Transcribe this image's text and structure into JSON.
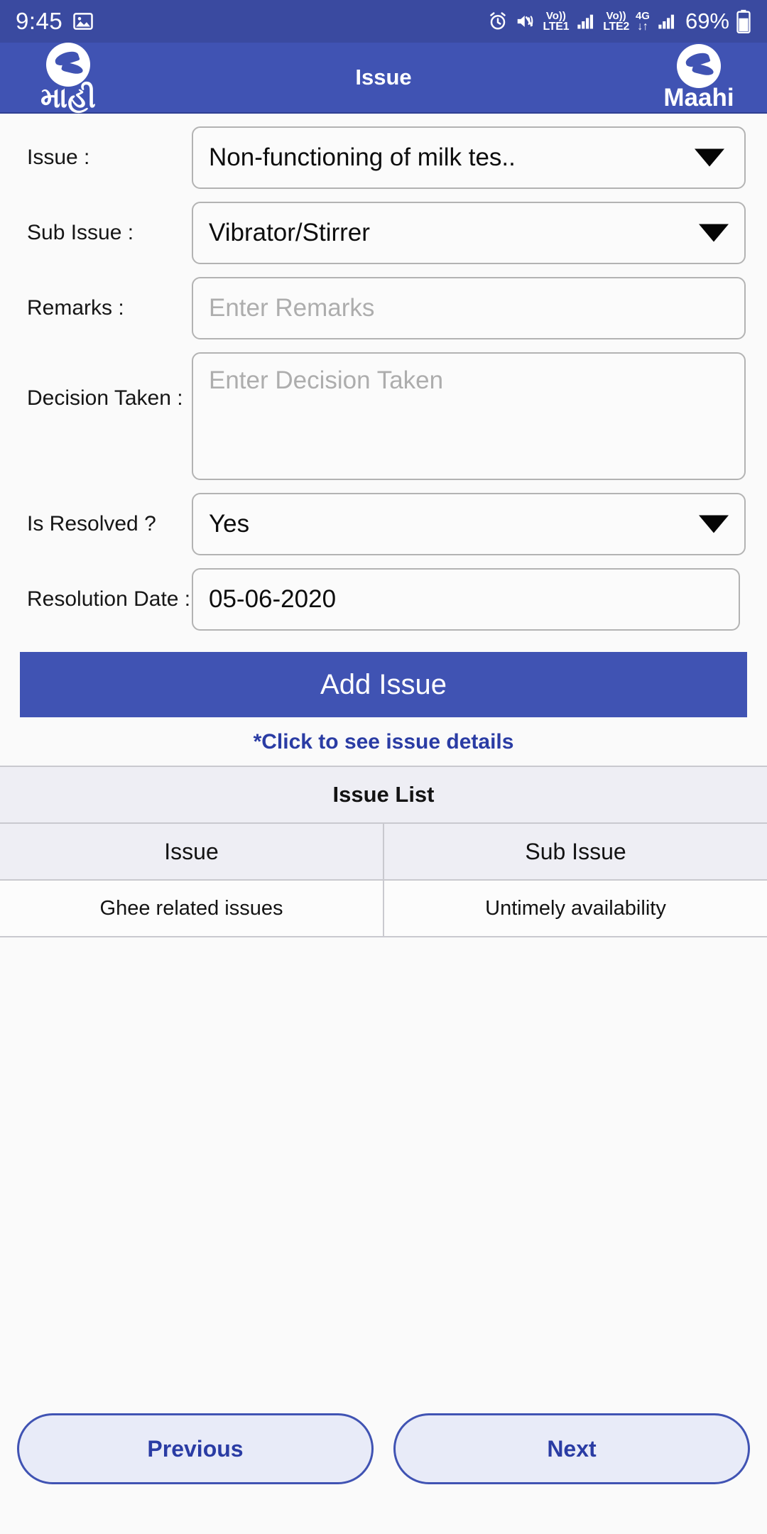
{
  "status_bar": {
    "time": "9:45",
    "battery_percent": "69%",
    "icons": {
      "gallery": "image-icon",
      "alarm": "alarm-icon",
      "mute": "volume-mute-vibrate-icon",
      "sim1_top": "Vo))",
      "sim1_bottom": "LTE1",
      "sim2_top": "Vo))",
      "sim2_bottom": "LTE2",
      "data_top": "4G",
      "data_bottom": "↓↑",
      "battery": "battery-icon"
    }
  },
  "app_bar": {
    "title": "Issue",
    "left_logo_text": "માહી",
    "right_logo_text": "Maahi",
    "brand_color": "#4053b3"
  },
  "form": {
    "issue": {
      "label": "Issue :",
      "value": "Non-functioning of milk tes..",
      "control": "dropdown"
    },
    "sub_issue": {
      "label": "Sub Issue :",
      "value": "Vibrator/Stirrer",
      "control": "dropdown"
    },
    "remarks": {
      "label": "Remarks :",
      "value": "",
      "placeholder": "Enter Remarks",
      "control": "text"
    },
    "decision_taken": {
      "label": "Decision Taken :",
      "value": "",
      "placeholder": "Enter Decision Taken",
      "control": "textarea"
    },
    "is_resolved": {
      "label": "Is Resolved ?",
      "value": "Yes",
      "control": "dropdown"
    },
    "resolution_date": {
      "label": "Resolution Date :",
      "value": "05-06-2020",
      "control": "date"
    }
  },
  "actions": {
    "add_issue_label": "Add Issue",
    "hint_text": "*Click to see issue details"
  },
  "issue_list": {
    "title": "Issue List",
    "columns": [
      "Issue",
      "Sub Issue"
    ],
    "rows": [
      {
        "issue": "Ghee related issues",
        "sub_issue": "Untimely availability"
      }
    ]
  },
  "navigation": {
    "previous_label": "Previous",
    "next_label": "Next"
  }
}
